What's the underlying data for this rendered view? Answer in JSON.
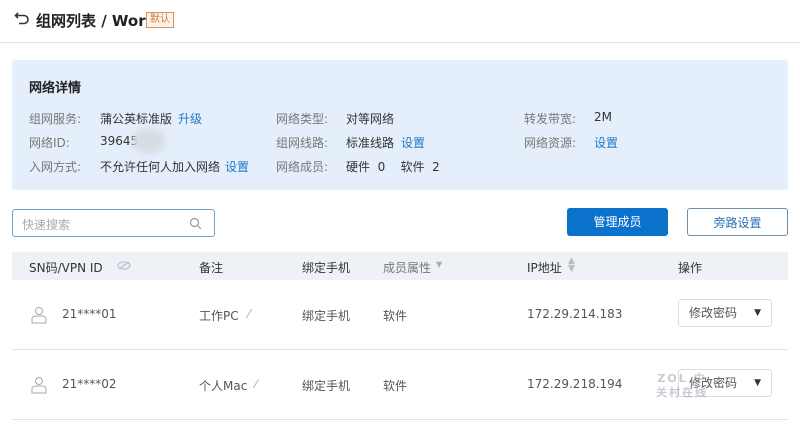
{
  "header": {
    "title": "组网列表 / Work",
    "badge": "默认"
  },
  "details": {
    "title": "网络详情",
    "service_label": "组网服务:",
    "service_value": "蒲公英标准版",
    "upgrade_link": "升级",
    "id_label": "网络ID:",
    "id_value": "39645",
    "join_label": "入网方式:",
    "join_value": "不允许任何人加入网络",
    "join_link": "设置",
    "type_label": "网络类型:",
    "type_value": "对等网络",
    "route_label": "组网线路:",
    "route_value": "标准线路",
    "route_link": "设置",
    "members_label": "网络成员:",
    "members_value": "硬件  0    软件  2",
    "bandwidth_label": "转发带宽:",
    "bandwidth_value": "2M",
    "resource_label": "网络资源:",
    "resource_link": "设置"
  },
  "search": {
    "placeholder": "快速搜索"
  },
  "buttons": {
    "manage": "管理成员",
    "bypass": "旁路设置"
  },
  "table": {
    "headers": [
      "SN码/VPN ID",
      "备注",
      "绑定手机",
      "成员属性",
      "IP地址",
      "操作"
    ],
    "rows": [
      {
        "id": "21****01",
        "note": "工作PC",
        "phone": "绑定手机",
        "type": "软件",
        "ip": "172.29.214.183",
        "action": "修改密码"
      },
      {
        "id": "21****02",
        "note": "个人Mac",
        "phone": "绑定手机",
        "type": "软件",
        "ip": "172.29.218.194",
        "action": "修改密码"
      }
    ]
  },
  "watermark": "ZOL 中关村在线"
}
